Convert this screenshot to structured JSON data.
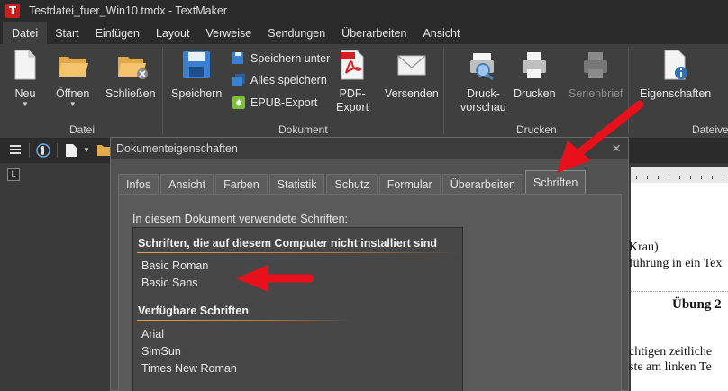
{
  "window": {
    "title": "Testdatei_fuer_Win10.tmdx - TextMaker",
    "app_icon_letter": "T"
  },
  "menu": [
    {
      "label": "Datei",
      "active": true
    },
    {
      "label": "Start"
    },
    {
      "label": "Einfügen"
    },
    {
      "label": "Layout"
    },
    {
      "label": "Verweise"
    },
    {
      "label": "Sendungen"
    },
    {
      "label": "Überarbeiten"
    },
    {
      "label": "Ansicht"
    }
  ],
  "ribbon": {
    "buttons": {
      "neu": "Neu",
      "oeffnen": "Öffnen",
      "schliessen": "Schließen",
      "speichern": "Speichern",
      "pdf_export_1": "PDF-",
      "pdf_export_2": "Export",
      "versenden": "Versenden",
      "druck_1": "Druck-",
      "druck_2": "vorschau",
      "drucken": "Drucken",
      "serienbrief": "Serienbrief",
      "eigenschaften": "Eigenschaften",
      "partial": "V"
    },
    "small_buttons": {
      "speichern_unter": "Speichern unter",
      "alles_speichern": "Alles speichern",
      "epub_export": "EPUB-Export"
    },
    "groups": {
      "datei": "Datei",
      "dokument": "Dokument",
      "drucken": "Drucken",
      "dateiv": "Dateive"
    }
  },
  "document": {
    "lines": [
      "Krau)",
      "führung in ein Tex",
      "chtigen zeitliche",
      "ste am linken Te"
    ],
    "heading": "Übung 2"
  },
  "dialog": {
    "title": "Dokumenteigenschaften",
    "close_icon": "×",
    "tabs": [
      {
        "label": "Infos"
      },
      {
        "label": "Ansicht"
      },
      {
        "label": "Farben"
      },
      {
        "label": "Statistik"
      },
      {
        "label": "Schutz"
      },
      {
        "label": "Formular"
      },
      {
        "label": "Überarbeiten"
      },
      {
        "label": "Schriften",
        "active": true
      }
    ],
    "caption": "In diesem Dokument verwendete Schriften:",
    "section_missing": {
      "heading": "Schriften, die auf diesem Computer nicht installiert sind",
      "fonts": [
        "Basic Roman",
        "Basic Sans"
      ]
    },
    "section_available": {
      "heading": "Verfügbare Schriften",
      "fonts": [
        "Arial",
        "SimSun",
        "Times New Roman"
      ]
    }
  },
  "colors": {
    "arrow_red": "#e8101a",
    "accent_orange": "#e2a24a",
    "app_red": "#c8201e"
  }
}
